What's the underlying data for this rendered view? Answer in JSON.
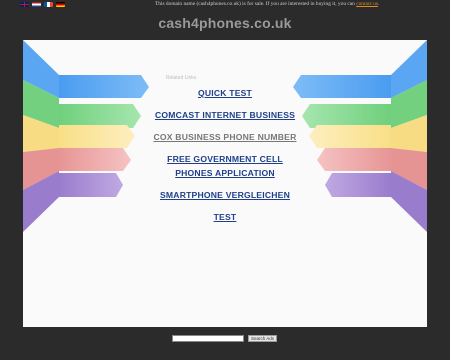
{
  "notice": {
    "text": "This domain name (cash4phones.co.uk) is for sale. If you are interested in buying it, you can",
    "link": "contact us",
    "end": "."
  },
  "site_title": "cash4phones.co.uk",
  "related_label": "Related Links",
  "links": [
    {
      "label": "QUICK TEST",
      "visited": false
    },
    {
      "label": "COMCAST INTERNET BUSINESS",
      "visited": false
    },
    {
      "label": "COX BUSINESS PHONE NUMBER",
      "visited": true
    },
    {
      "label": "FREE GOVERNMENT CELL PHONES APPLICATION",
      "visited": false
    },
    {
      "label": "SMARTPHONE VERGLEICHEN",
      "visited": false
    },
    {
      "label": "TEST",
      "visited": false
    }
  ],
  "search": {
    "button": "Search Ads",
    "value": ""
  },
  "colors": {
    "blue": "#5aa6f2",
    "green": "#7fd98a",
    "yellow": "#fbe59a",
    "red": "#eea6a6",
    "purple": "#a98ad3"
  },
  "flags": [
    "uk-flag-icon",
    "nl-flag-icon",
    "fr-flag-icon",
    "de-flag-icon"
  ]
}
